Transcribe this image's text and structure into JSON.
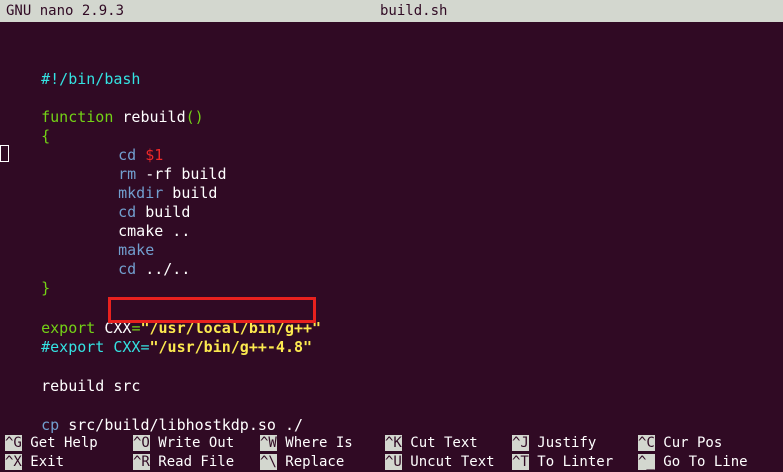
{
  "titlebar": {
    "app": "GNU nano 2.9.3",
    "filename": "build.sh"
  },
  "code": {
    "shebang": "#!/bin/bash",
    "function_kw": "function",
    "function_name": " rebuild",
    "function_parens": "()",
    "open_brace": "{",
    "cd1_cmd": "cd",
    "cd1_arg": " $1",
    "rm_cmd": "rm",
    "rm_args": " -rf build",
    "mkdir_cmd": "mkdir",
    "mkdir_args": " build",
    "cd2_cmd": "cd",
    "cd2_args": " build",
    "cmake_line": "cmake ..",
    "make_cmd": "make",
    "cd3_cmd": "cd",
    "cd3_args": " ../..",
    "close_brace": "}",
    "export1_kw": "export",
    "export1_var": " CXX",
    "export1_eq": "=",
    "export1_val": "\"/usr/local/bin/g++\"",
    "export2_comment": "#export CXX=",
    "export2_val": "\"/usr/bin/g++-4.8\"",
    "rebuild_call": "rebuild src",
    "cp_cmd": "cp",
    "cp_args": " src/build/libhostkdp.so ./"
  },
  "shortcuts": {
    "row1": [
      {
        "key": "^G",
        "label": " Get Help"
      },
      {
        "key": "^O",
        "label": " Write Out"
      },
      {
        "key": "^W",
        "label": " Where Is"
      },
      {
        "key": "^K",
        "label": " Cut Text"
      },
      {
        "key": "^J",
        "label": " Justify"
      },
      {
        "key": "^C",
        "label": " Cur Pos"
      }
    ],
    "row2": [
      {
        "key": "^X",
        "label": " Exit"
      },
      {
        "key": "^R",
        "label": " Read File"
      },
      {
        "key": "^\\",
        "label": " Replace"
      },
      {
        "key": "^U",
        "label": " Uncut Text"
      },
      {
        "key": "^T",
        "label": " To Linter"
      },
      {
        "key": "^_",
        "label": " Go To Line"
      }
    ]
  }
}
